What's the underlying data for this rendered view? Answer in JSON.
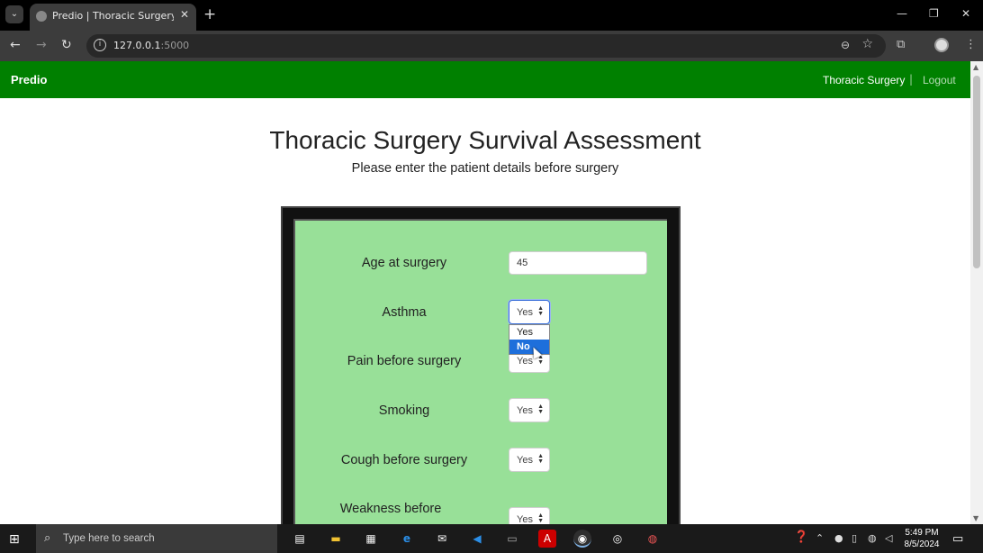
{
  "browser": {
    "tab_title": "Predio | Thoracic Surgery Survival",
    "url_host": "127.0.0.1",
    "url_port": ":5000",
    "icons": {
      "tab_dropdown": "chevron-down-icon",
      "favicon": "globe-icon",
      "tab_close": "close-icon",
      "new_tab": "plus-icon",
      "minimize": "minimize-icon",
      "maximize": "restore-icon",
      "window_close": "close-icon",
      "back": "arrow-left-icon",
      "forward": "arrow-right-icon",
      "reload": "reload-icon",
      "site_info": "info-icon",
      "zoom": "zoom-icon",
      "bookmark": "star-icon",
      "extensions": "puzzle-icon",
      "profile": "avatar-icon",
      "menu": "more-vertical-icon"
    }
  },
  "navbar": {
    "brand": "Predio",
    "links": [
      "Thoracic Surgery",
      "Logout"
    ],
    "separator": "|",
    "color": "#008000"
  },
  "page": {
    "title": "Thoracic Surgery Survival Assessment",
    "subtitle": "Please enter the patient details before surgery"
  },
  "form": {
    "background": "#98e098",
    "fields": [
      {
        "label": "Age at surgery",
        "value": "45"
      },
      {
        "label": "Asthma",
        "value": "Yes"
      },
      {
        "label": "Pain before surgery",
        "value": "Yes"
      },
      {
        "label": "Smoking",
        "value": "Yes"
      },
      {
        "label": "Cough before surgery",
        "value": "Yes"
      },
      {
        "label": "Weakness before",
        "value": "Yes"
      }
    ],
    "open_dropdown": {
      "options": [
        "Yes",
        "No"
      ],
      "highlighted": "No"
    }
  },
  "taskbar": {
    "search_placeholder": "Type here to search",
    "time": "5:49 PM",
    "date": "8/5/2024"
  }
}
